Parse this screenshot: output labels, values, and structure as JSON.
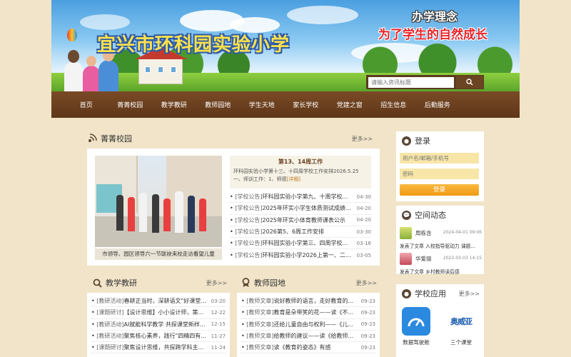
{
  "header": {
    "school_name": "宜兴市环科园实验小学",
    "motto_title": "办学理念",
    "motto_text": "为了学生的自然成长",
    "search_placeholder": "请输入资讯标题"
  },
  "nav": [
    "首页",
    "菁菁校园",
    "教学教研",
    "教师园地",
    "学生天地",
    "家长学校",
    "党建之窗",
    "招生信息",
    "后勤服务"
  ],
  "campus": {
    "title": "菁菁校园",
    "more": "更多>>",
    "photo_caption": "市领导、园区领导六一节联袂来校走访看望儿童",
    "featured_title": "第13、14周工作",
    "featured_text": "环科园实验小学第十三、十四周学校工作安排2026.5.25一、师训工作：1、师德",
    "featured_link": "[详细]",
    "items": [
      {
        "cat": "[学校公告]",
        "text": "环科园实验小学第九、十周学校工...",
        "date": "04-30"
      },
      {
        "cat": "[学校公告]",
        "text": "2025年环实小学生体质测试成绩公示",
        "date": "04-20"
      },
      {
        "cat": "[学校公告]",
        "text": "2025年环实小体育教师课表公示",
        "date": "04-20"
      },
      {
        "cat": "[学校公告]",
        "text": "2026第5、6周工作安排",
        "date": "03-30"
      },
      {
        "cat": "[学校公告]",
        "text": "环科园实验小学第三、四周学校工...",
        "date": "03-16"
      },
      {
        "cat": "[学校公告]",
        "text": "环科园实验小学2026上第一、二周...",
        "date": "03-05"
      }
    ]
  },
  "teaching": {
    "title": "教学教研",
    "more": "更多>>",
    "items": [
      {
        "cat": "[教研活动]",
        "text": "春耕正当时，深耕语文\"好课堂...",
        "date": "03-20"
      },
      {
        "cat": "[课题研讨]",
        "text": "【设计思维】小小设计师，策...",
        "date": "12-22"
      },
      {
        "cat": "[教研活动]",
        "text": "AI赋能科学教学 共探课堂新样...",
        "date": "12-15"
      },
      {
        "cat": "[教研活动]",
        "text": "聚焦核心素养，践行\"四精四有...",
        "date": "11-27"
      },
      {
        "cat": "[课题研讨]",
        "text": "聚焦设计思维，共探跨学科主...",
        "date": "11-24"
      }
    ]
  },
  "teachers": {
    "title": "教师园地",
    "more": "更多>>",
    "items": [
      {
        "cat": "[教师文章]",
        "text": "说好教师的语言，走好教育的...",
        "date": "09-23"
      },
      {
        "cat": "[教师文章]",
        "text": "教育是朵带笑的花——读《不...",
        "date": "09-23"
      },
      {
        "cat": "[教师文章]",
        "text": "还给儿童自由与权利——《儿...",
        "date": "09-23"
      },
      {
        "cat": "[教师文章]",
        "text": "给教师的建议——读《给教师...",
        "date": "09-23"
      },
      {
        "cat": "[教师文章]",
        "text": "读《教育的姿态》有感",
        "date": "09-23"
      }
    ]
  },
  "login": {
    "title": "登录",
    "user_placeholder": "用户名/邮箱/手机号",
    "pass_placeholder": "密码",
    "button": "登录"
  },
  "space": {
    "title": "空间动态",
    "items": [
      {
        "name": "周栋含",
        "time": "2024-04-01 09:06",
        "text": "发表了文章 入校指导驱动力 课题..."
      },
      {
        "name": "华爱丽",
        "time": "2022-03-03 14:15",
        "text": "发表了文章 乡村教师读后感"
      }
    ]
  },
  "apps": {
    "title": "学校应用",
    "more": "更多>>",
    "items": [
      {
        "label": "数据驾驶舱",
        "icon": "dashboard-icon"
      },
      {
        "label": "三个课堂",
        "icon": "classroom-logo-icon",
        "logo_text": "奥威亚"
      }
    ]
  },
  "colors": {
    "nav_brown": "#6b3f1f",
    "accent_orange": "#f5a21a",
    "title_yellow": "#ffe24a",
    "motto_red": "#e8252a"
  }
}
